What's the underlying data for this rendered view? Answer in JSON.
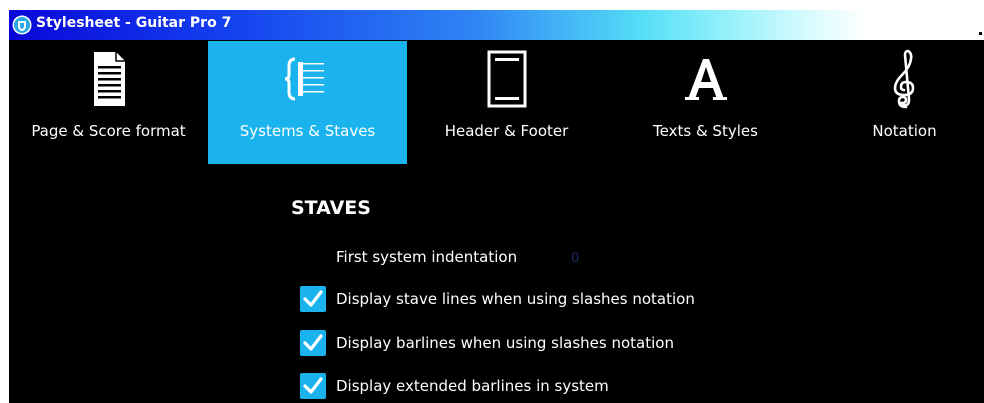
{
  "window": {
    "title": "Stylesheet - Guitar Pro 7",
    "icon": "guitar-pro-icon"
  },
  "tabs": [
    {
      "label": "Page & Score format",
      "icon": "page-document-icon",
      "selected": false
    },
    {
      "label": "Systems & Staves",
      "icon": "brace-staves-icon",
      "selected": true
    },
    {
      "label": "Header & Footer",
      "icon": "header-footer-icon",
      "selected": false
    },
    {
      "label": "Texts & Styles",
      "icon": "letter-a-icon",
      "selected": false
    },
    {
      "label": "Notation",
      "icon": "treble-clef-icon",
      "selected": false
    }
  ],
  "section": {
    "title": "STAVES",
    "indentation": {
      "label": "First system indentation",
      "value": "0"
    },
    "options": [
      {
        "label": "Display stave lines when using slashes notation",
        "checked": true
      },
      {
        "label": "Display barlines when using slashes notation",
        "checked": true
      },
      {
        "label": "Display extended barlines in system",
        "checked": true
      }
    ]
  },
  "colors": {
    "accent": "#1ab3ee",
    "background": "#000000",
    "titlebar_start": "#0a07d8",
    "text": "#ffffff"
  }
}
